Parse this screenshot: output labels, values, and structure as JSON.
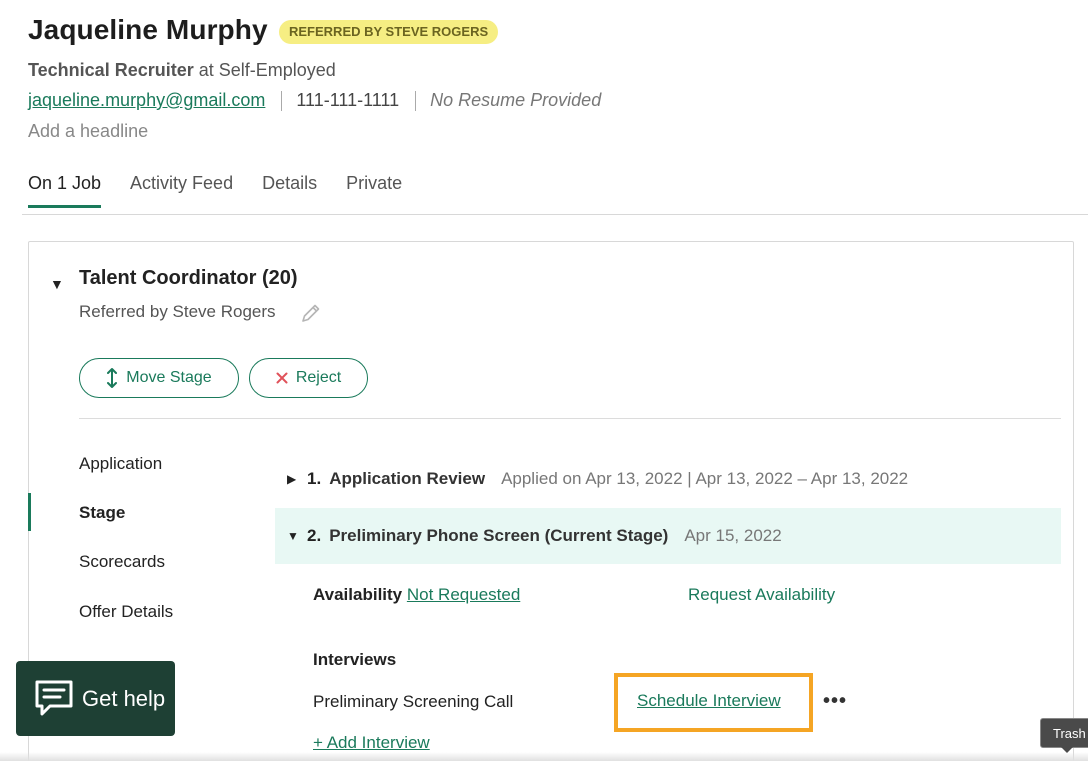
{
  "candidate": {
    "name": "Jaqueline Murphy",
    "referral_badge": "REFERRED BY STEVE ROGERS",
    "job_title": "Technical Recruiter",
    "at_text": "at Self-Employed",
    "email": "jaqueline.murphy@gmail.com",
    "phone": "111-111-1111",
    "resume_status": "No Resume Provided",
    "headline_placeholder": "Add a headline"
  },
  "tabs": [
    {
      "label": "On 1 Job",
      "active": true
    },
    {
      "label": "Activity Feed",
      "active": false
    },
    {
      "label": "Details",
      "active": false
    },
    {
      "label": "Private",
      "active": false
    }
  ],
  "job": {
    "title": "Talent Coordinator (20)",
    "referred_by": "Referred by Steve Rogers",
    "move_stage_label": "Move Stage",
    "reject_label": "Reject"
  },
  "sidenav": [
    {
      "label": "Application",
      "active": false
    },
    {
      "label": "Stage",
      "active": true
    },
    {
      "label": "Scorecards",
      "active": false
    },
    {
      "label": "Offer Details",
      "active": false
    }
  ],
  "stages": [
    {
      "num": "1.",
      "name": "Application Review",
      "date": "Applied on Apr 13, 2022 | Apr 13, 2022 – Apr 13, 2022",
      "current": false
    },
    {
      "num": "2.",
      "name": "Preliminary Phone Screen (Current Stage)",
      "date": "Apr 15, 2022",
      "current": true
    }
  ],
  "availability": {
    "label": "Availability",
    "status": "Not Requested",
    "request_label": "Request Availability"
  },
  "interviews": {
    "heading": "Interviews",
    "items": [
      {
        "name": "Preliminary Screening Call",
        "action": "Schedule Interview"
      }
    ],
    "add_label": "+ Add Interview"
  },
  "help": {
    "label": "Get help"
  },
  "tooltip": {
    "text": "Trash"
  },
  "colors": {
    "accent": "#1a7a5b",
    "badge_bg": "#f6ee83",
    "current_stage_bg": "#e8f8f4",
    "highlight": "#f5a524",
    "reject_icon": "#e0525a",
    "help_bg": "#1e4034"
  },
  "icons": [
    "pencil-icon",
    "move-stage-icon",
    "reject-x-icon",
    "caret-down-icon",
    "caret-right-icon",
    "chat-icon",
    "more-icon"
  ]
}
